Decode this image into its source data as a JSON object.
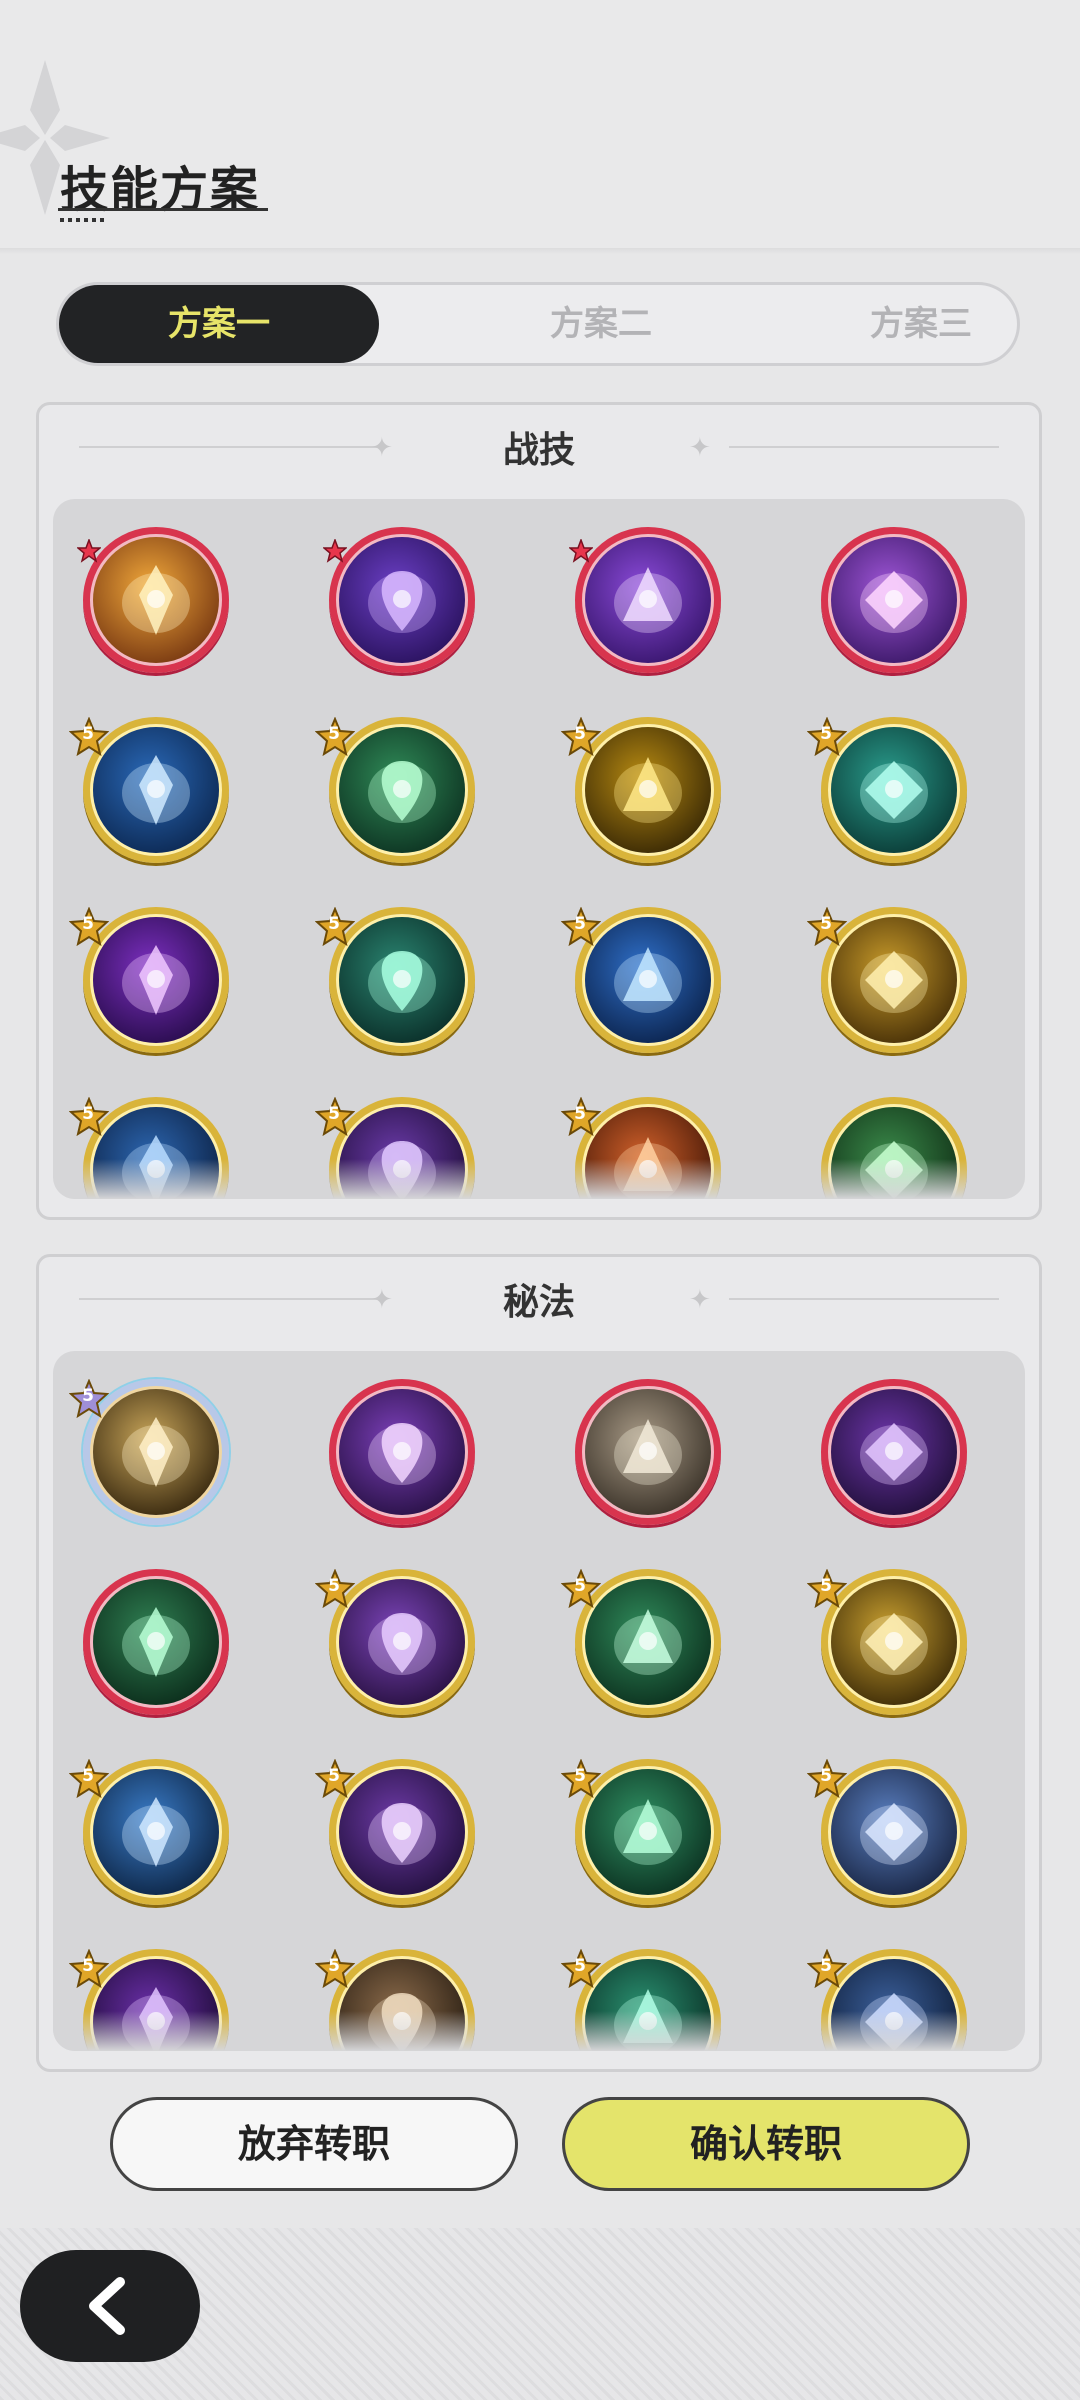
{
  "header": {
    "title": "技能方案"
  },
  "tabs": [
    {
      "label": "方案一",
      "active": true
    },
    {
      "label": "方案二",
      "active": false
    },
    {
      "label": "方案三",
      "active": false
    }
  ],
  "panels": [
    {
      "title": "战技",
      "skills": [
        {
          "icon": "golden-bear-guardian-icon",
          "rarity": "red",
          "badge": "",
          "star": true,
          "palette": [
            "#f2a93b",
            "#7a3a12",
            "#fff2c0"
          ]
        },
        {
          "icon": "purple-vortex-icon",
          "rarity": "red",
          "badge": "",
          "star": true,
          "palette": [
            "#6b3fc5",
            "#2b1360",
            "#d8b8ff"
          ]
        },
        {
          "icon": "violet-crest-icon",
          "rarity": "red",
          "badge": "",
          "star": true,
          "palette": [
            "#8a4ad8",
            "#3a1770",
            "#f0dcff"
          ]
        },
        {
          "icon": "crowned-figure-icon",
          "rarity": "red",
          "badge": "",
          "star": false,
          "palette": [
            "#9e55d6",
            "#3e1a6b",
            "#ffd7ff"
          ]
        },
        {
          "icon": "ice-burst-icon",
          "rarity": "gold",
          "badge": "5",
          "star": false,
          "palette": [
            "#2a69b8",
            "#0d2a55",
            "#cfeaff"
          ]
        },
        {
          "icon": "green-comet-icon",
          "rarity": "gold",
          "badge": "5",
          "star": false,
          "palette": [
            "#2f8a57",
            "#0e3523",
            "#b7ffd2"
          ]
        },
        {
          "icon": "golden-prism-icon",
          "rarity": "gold",
          "badge": "5",
          "star": false,
          "palette": [
            "#b88b12",
            "#3b2a05",
            "#ffe98a"
          ]
        },
        {
          "icon": "teal-spiral-icon",
          "rarity": "gold",
          "badge": "5",
          "star": false,
          "palette": [
            "#2a9c8c",
            "#0b3d38",
            "#b4fff0"
          ]
        },
        {
          "icon": "violet-sparkle-icon",
          "rarity": "gold",
          "badge": "5",
          "star": false,
          "palette": [
            "#7c2fc0",
            "#2a0d4f",
            "#f0c8ff"
          ]
        },
        {
          "icon": "meditating-spirit-icon",
          "rarity": "gold",
          "badge": "5",
          "star": false,
          "palette": [
            "#2a8470",
            "#0b302a",
            "#a8ffe0"
          ]
        },
        {
          "icon": "blue-flame-icon",
          "rarity": "gold",
          "badge": "5",
          "star": false,
          "palette": [
            "#2f6fc8",
            "#0c2550",
            "#c2e6ff"
          ]
        },
        {
          "icon": "golden-stars-icon",
          "rarity": "gold",
          "badge": "5",
          "star": false,
          "palette": [
            "#c79a2a",
            "#4a3208",
            "#fff0b0"
          ]
        },
        {
          "icon": "blue-wave-icon",
          "rarity": "gold",
          "badge": "5",
          "star": false,
          "palette": [
            "#2c66b0",
            "#0d2347",
            "#b9dcff"
          ]
        },
        {
          "icon": "purple-emblem-icon",
          "rarity": "gold",
          "badge": "5",
          "star": false,
          "palette": [
            "#6a3aa8",
            "#241040",
            "#e0c8ff"
          ]
        },
        {
          "icon": "orange-fire-icon",
          "rarity": "gold",
          "badge": "5",
          "star": false,
          "palette": [
            "#d0602a",
            "#4a1a08",
            "#ffd0a0"
          ]
        },
        {
          "icon": "green-banner-icon",
          "rarity": "gold",
          "badge": "",
          "star": false,
          "palette": [
            "#3a8a4a",
            "#123318",
            "#c8ffd0"
          ]
        }
      ]
    },
    {
      "title": "秘法",
      "skills": [
        {
          "icon": "golden-figure-icon",
          "rarity": "rainbow",
          "badge": "5",
          "star": false,
          "palette": [
            "#c9a65a",
            "#3a2a10",
            "#fff0c8"
          ]
        },
        {
          "icon": "purple-heart-icon",
          "rarity": "red",
          "badge": "",
          "star": false,
          "palette": [
            "#7b3fb8",
            "#2a1248",
            "#f2d6ff"
          ]
        },
        {
          "icon": "stone-child-icon",
          "rarity": "red",
          "badge": "",
          "star": false,
          "palette": [
            "#a89a86",
            "#3c342a",
            "#f2ead8"
          ]
        },
        {
          "icon": "purple-serpent-icon",
          "rarity": "red",
          "badge": "",
          "star": false,
          "palette": [
            "#6c35a8",
            "#22103c",
            "#e4c8ff"
          ]
        },
        {
          "icon": "green-cathedral-icon",
          "rarity": "red",
          "badge": "",
          "star": false,
          "palette": [
            "#2f7f52",
            "#0c2e1c",
            "#b8ffd6"
          ]
        },
        {
          "icon": "violet-petal-icon",
          "rarity": "gold",
          "badge": "5",
          "star": false,
          "palette": [
            "#7b44b8",
            "#2a1244",
            "#e8ccff"
          ]
        },
        {
          "icon": "green-winged-star-icon",
          "rarity": "gold",
          "badge": "5",
          "star": false,
          "palette": [
            "#2f8a5a",
            "#0d3320",
            "#c8ffe0"
          ]
        },
        {
          "icon": "golden-burst-icon",
          "rarity": "gold",
          "badge": "5",
          "star": false,
          "palette": [
            "#c9a030",
            "#3f2d08",
            "#fff1b8"
          ]
        },
        {
          "icon": "blue-crystal-icon",
          "rarity": "gold",
          "badge": "5",
          "star": false,
          "palette": [
            "#3a7cc8",
            "#0e2748",
            "#cfe8ff"
          ]
        },
        {
          "icon": "violet-eye-icon",
          "rarity": "gold",
          "badge": "5",
          "star": false,
          "palette": [
            "#6d3aa6",
            "#241140",
            "#ecd2ff"
          ]
        },
        {
          "icon": "green-heart-icon",
          "rarity": "gold",
          "badge": "5",
          "star": false,
          "palette": [
            "#2f8f62",
            "#0c3322",
            "#b6ffda"
          ]
        },
        {
          "icon": "blue-armor-icon",
          "rarity": "gold",
          "badge": "5",
          "star": false,
          "palette": [
            "#5a7fc0",
            "#1a2746",
            "#dce8ff"
          ]
        },
        {
          "icon": "purple-sigil-icon",
          "rarity": "gold",
          "badge": "5",
          "star": false,
          "palette": [
            "#6a2fa8",
            "#200c3a",
            "#e2c4ff"
          ]
        },
        {
          "icon": "bronze-ruin-icon",
          "rarity": "gold",
          "badge": "5",
          "star": false,
          "palette": [
            "#8a6a4a",
            "#2c2014",
            "#f0dcc0"
          ]
        },
        {
          "icon": "green-orb-icon",
          "rarity": "gold",
          "badge": "5",
          "star": false,
          "palette": [
            "#2a9070",
            "#0b3328",
            "#b2ffe6"
          ]
        },
        {
          "icon": "blue-mountain-icon",
          "rarity": "gold",
          "badge": "5",
          "star": false,
          "palette": [
            "#3b5f9a",
            "#10203c",
            "#cddcff"
          ]
        }
      ]
    }
  ],
  "buttons": {
    "abandon": "放弃转职",
    "confirm": "确认转职"
  },
  "nav": {
    "back_icon": "chevron-left-icon"
  }
}
